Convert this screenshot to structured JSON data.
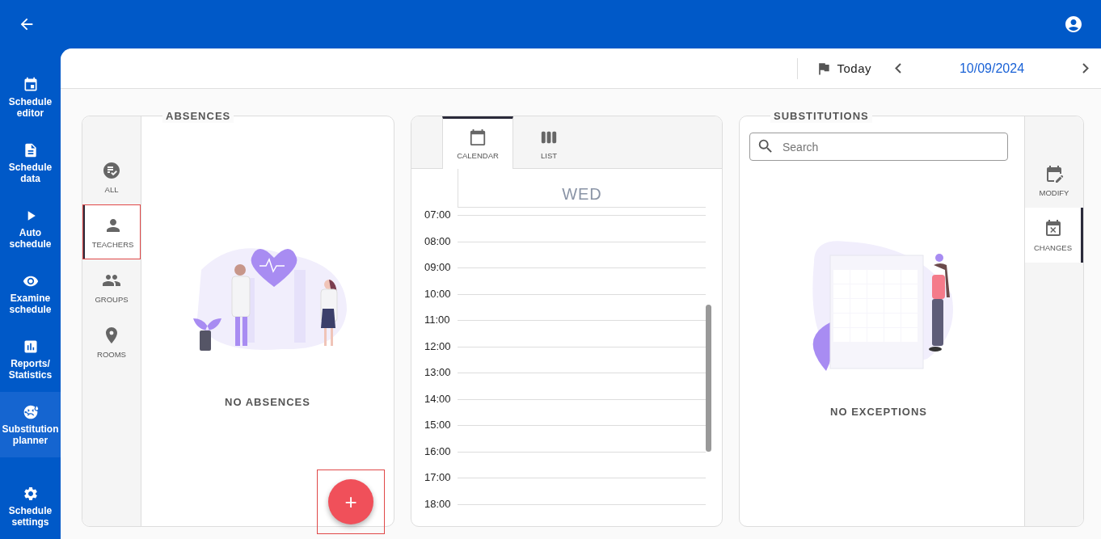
{
  "nav": {
    "items": [
      {
        "label": "Schedule editor",
        "selected": false
      },
      {
        "label": "Schedule data",
        "selected": false
      },
      {
        "label": "Auto schedule",
        "selected": false
      },
      {
        "label": "Examine schedule",
        "selected": false
      },
      {
        "label": "Reports/ Statistics",
        "selected": false
      },
      {
        "label": "Substitution planner",
        "selected": true
      }
    ],
    "bottom_item": {
      "label": "Schedule settings",
      "selected": false
    }
  },
  "toolbar": {
    "today": "Today",
    "date": "10/09/2024"
  },
  "absences": {
    "title": "ABSENCES",
    "tabs": [
      {
        "label": "ALL",
        "selected": false,
        "highlighted": false
      },
      {
        "label": "TEACHERS",
        "selected": true,
        "highlighted": true
      },
      {
        "label": "GROUPS",
        "selected": false,
        "highlighted": false
      },
      {
        "label": "ROOMS",
        "selected": false,
        "highlighted": false
      }
    ],
    "empty_text": "NO ABSENCES",
    "add_button": {
      "label": "+",
      "highlighted": true
    }
  },
  "calendar": {
    "tabs": [
      {
        "label": "CALENDAR",
        "selected": true
      },
      {
        "label": "LIST",
        "selected": false
      }
    ],
    "day": "WED",
    "hours": [
      "07:00",
      "08:00",
      "09:00",
      "10:00",
      "11:00",
      "12:00",
      "13:00",
      "14:00",
      "15:00",
      "16:00",
      "17:00",
      "18:00"
    ]
  },
  "substitutions": {
    "title": "SUBSTITUTIONS",
    "search": {
      "placeholder": "Search"
    },
    "empty_text": "NO EXCEPTIONS",
    "tabs": [
      {
        "label": "MODIFY",
        "selected": false
      },
      {
        "label": "CHANGES",
        "selected": true
      }
    ]
  }
}
